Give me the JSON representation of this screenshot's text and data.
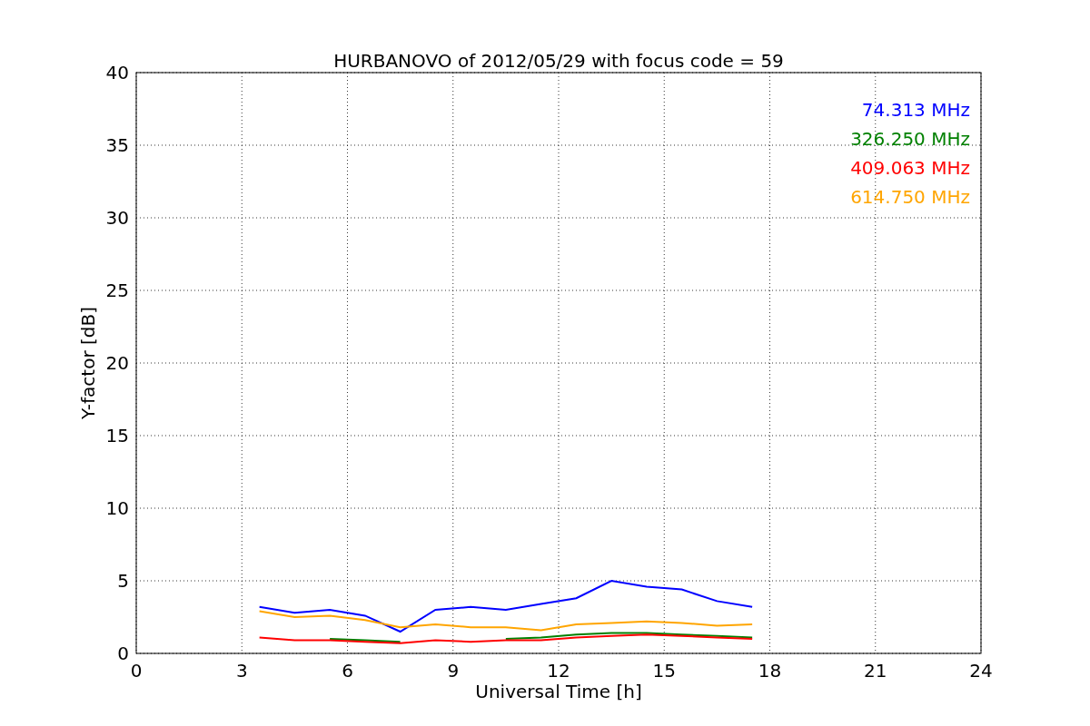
{
  "chart_data": {
    "type": "line",
    "title": "HURBANOVO of 2012/05/29 with focus code = 59",
    "xlabel": "Universal Time [h]",
    "ylabel": "Y-factor [dB]",
    "x": [
      3.5,
      4.5,
      5.5,
      6.5,
      7.5,
      8.5,
      9.5,
      10.5,
      11.5,
      12.5,
      13.5,
      14.5,
      15.5,
      16.5,
      17.5
    ],
    "series": [
      {
        "name": "74.313 MHz",
        "color": "#0000ff",
        "values": [
          3.2,
          2.8,
          3.0,
          2.6,
          1.5,
          3.0,
          3.2,
          3.0,
          3.4,
          3.8,
          5.0,
          4.6,
          4.4,
          3.6,
          3.2
        ]
      },
      {
        "name": "326.250 MHz",
        "color": "#008000",
        "values": [
          null,
          null,
          1.0,
          0.9,
          0.8,
          null,
          null,
          1.0,
          1.1,
          1.3,
          1.4,
          1.4,
          1.3,
          1.2,
          1.1
        ]
      },
      {
        "name": "409.063 MHz",
        "color": "#ff0000",
        "values": [
          1.1,
          0.9,
          0.9,
          0.8,
          0.7,
          0.9,
          0.8,
          0.9,
          0.9,
          1.1,
          1.2,
          1.3,
          1.2,
          1.1,
          1.0
        ]
      },
      {
        "name": "614.750 MHz",
        "color": "#ffa500",
        "values": [
          2.9,
          2.5,
          2.6,
          2.3,
          1.8,
          2.0,
          1.8,
          1.8,
          1.6,
          2.0,
          2.1,
          2.2,
          2.1,
          1.9,
          2.0
        ]
      }
    ],
    "grid": true,
    "xlim": [
      0,
      24
    ],
    "ylim": [
      0,
      40
    ],
    "xticks": [
      0,
      3,
      6,
      9,
      12,
      15,
      18,
      21,
      24
    ],
    "yticks": [
      0,
      5,
      10,
      15,
      20,
      25,
      30,
      35,
      40
    ]
  }
}
